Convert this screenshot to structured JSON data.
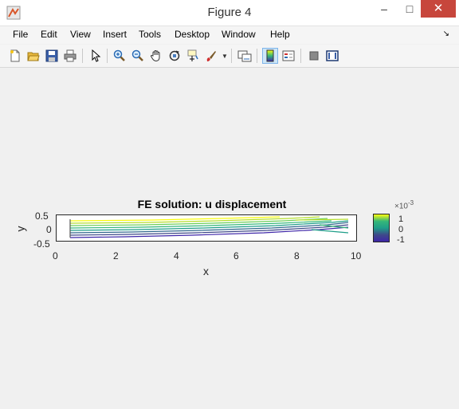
{
  "window": {
    "title": "Figure 4",
    "minimize": "–",
    "maximize": "□",
    "close": "✕"
  },
  "menu": [
    "File",
    "Edit",
    "View",
    "Insert",
    "Tools",
    "Desktop",
    "Window",
    "Help"
  ],
  "menu_arrow": "↘",
  "toolbar": {
    "buttons": [
      "new-figure",
      "open-file",
      "save",
      "print",
      "pointer",
      "zoom-in",
      "zoom-out",
      "pan",
      "rotate-3d",
      "data-cursor",
      "brush",
      "link-plot",
      "colorbar-toggle",
      "legend-toggle",
      "hide-plot-tools",
      "show-plot-tools"
    ]
  },
  "plot": {
    "title": "FE solution: u displacement",
    "xlabel": "x",
    "ylabel": "y",
    "xticks": [
      "0",
      "2",
      "4",
      "6",
      "8",
      "10"
    ],
    "yticks": [
      "0.5",
      "0",
      "-0.5"
    ],
    "colorbar_ticks": [
      "1",
      "0",
      "-1"
    ],
    "colorbar_multiplier": "×10",
    "colorbar_exponent": "-3"
  },
  "colors": {
    "close": "#c7463c",
    "accent": "#0072bd"
  }
}
